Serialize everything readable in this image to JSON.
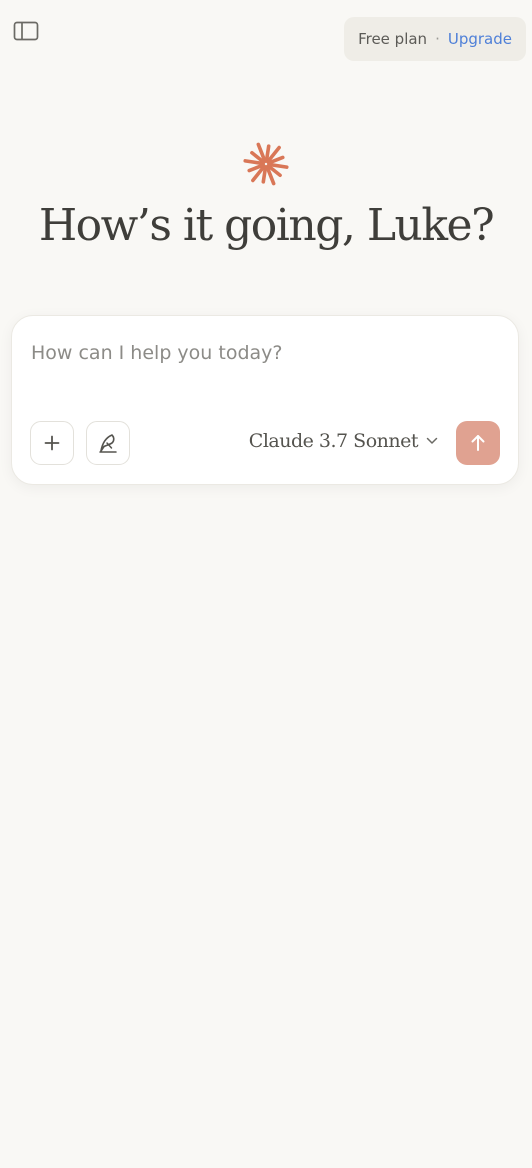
{
  "header": {
    "sidebar_toggle_icon": "sidebar-panel-icon",
    "plan_label": "Free plan",
    "separator": "·",
    "upgrade_label": "Upgrade"
  },
  "hero": {
    "logo_icon": "starburst-icon",
    "greeting": "How’s it going, Luke?"
  },
  "composer": {
    "placeholder": "How can I help you today?",
    "value": "",
    "add_icon": "plus-icon",
    "style_icon": "pen-nib-icon",
    "model_name": "Claude 3.7 Sonnet",
    "model_dropdown_icon": "chevron-down-icon",
    "send_icon": "arrow-up-icon"
  },
  "colors": {
    "background": "#f9f8f5",
    "accent": "#d97757",
    "send_button": "#e0a291",
    "upgrade_link": "#4f80d8"
  }
}
